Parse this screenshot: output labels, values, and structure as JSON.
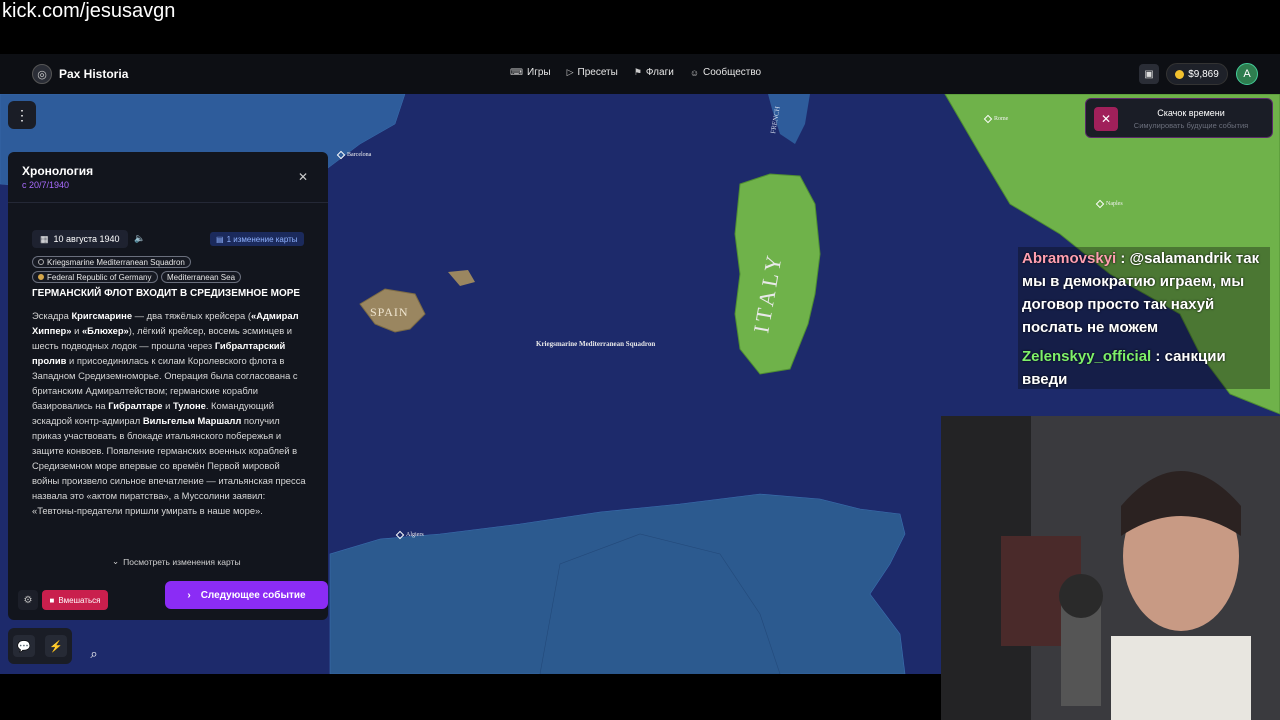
{
  "stream": {
    "url_label": "kick.com/jesusavgn"
  },
  "app": {
    "brand": "Pax Historia",
    "nav": [
      {
        "label": "Игры",
        "icon": "gamepad-icon"
      },
      {
        "label": "Пресеты",
        "icon": "play-icon"
      },
      {
        "label": "Флаги",
        "icon": "flag-icon"
      },
      {
        "label": "Сообщество",
        "icon": "people-icon"
      }
    ],
    "balance": "$9,869",
    "avatar_letter": "A",
    "colors": {
      "accent_purple": "#8b2cf5",
      "intervene_red": "#c91f4d",
      "sea": "#1d2a6b",
      "land_italy": "#6fb24a",
      "land_africa": "#2c5a8f"
    }
  },
  "timejump": {
    "title": "Скачок времени",
    "subtitle": "Симулировать будущие события"
  },
  "timeline": {
    "title": "Хронология",
    "since": "с 20/7/1940",
    "event": {
      "date": "10 августа 1940",
      "map_changes": "1 изменение карты",
      "tags": [
        "Kriegsmarine Mediterranean Squadron",
        "Federal Republic of Germany",
        "Mediterranean Sea"
      ],
      "title": "ГЕРМАНСКИЙ ФЛОТ ВХОДИТ В СРЕДИЗЕМНОЕ МОРЕ",
      "body_html_parts": [
        "Эскадра ",
        "Кригсмарине",
        " — два тяжёлых крейсера (",
        "«Адмирал Хиппер»",
        " и ",
        "«Блюхер»",
        "), лёгкий крейсер, восемь эсминцев и шесть подводных лодок — прошла через ",
        "Гибралтарский пролив",
        " и присоединилась к силам Королевского флота в Западном Средиземноморье. Операция была согласована с британским Адмиралтейством; германские корабли базировались на ",
        "Гибралтаре",
        " и ",
        "Тулоне",
        ". Командующий эскадрой контр-адмирал ",
        "Вильгельм Маршалл",
        " получил приказ участвовать в блокаде итальянского побережья и защите конвоев. Появление германских военных кораблей в Средиземном море впервые со времён Первой мировой войны произвело сильное впечатление — итальянская пресса назвала это «актом пиратства», а Муссолини заявил: «Тевтоны-предатели пришли умирать в наше море»."
      ]
    },
    "view_changes": "Посмотреть изменения карты",
    "intervene": "Вмешаться",
    "next_event": "Следующее событие"
  },
  "map": {
    "labels": {
      "barcelona": "Barcelona",
      "algiers": "Algiers",
      "naples": "Naples",
      "rome": "Rome",
      "squadron": "Kriegsmarine Mediterranean Squadron",
      "italy": "ITALY",
      "spain": "SPAIN",
      "french": "FRENCH"
    }
  },
  "chat": [
    {
      "user": "Abramovskyi",
      "message": ": @salamandrik так мы в демократию играем, мы договор просто так нахуй послать не можем"
    },
    {
      "user": "Zelenskyy_official",
      "message": ": санкции введи"
    }
  ]
}
